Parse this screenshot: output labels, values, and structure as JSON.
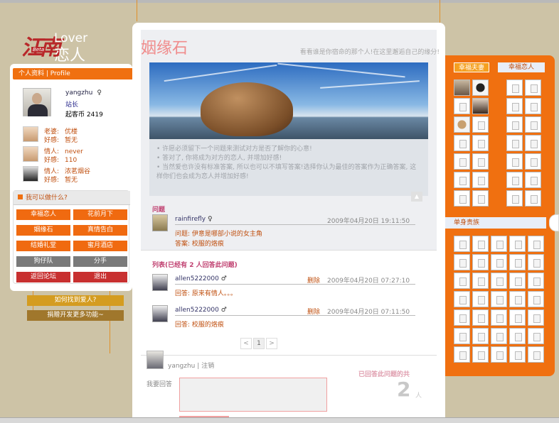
{
  "logo": {
    "cn": "江南",
    "beta": "Beta",
    "en": "Lover",
    "cn2": "恋人"
  },
  "profile": {
    "header": "个人资料 | Profile",
    "username": "yangzhu",
    "gender": "♀",
    "role": "站长",
    "coins_label": "起客币",
    "coins": "2419"
  },
  "relations": [
    {
      "rel": "老婆:",
      "name": "优楼",
      "fav_label": "好感:",
      "fav": "暂无"
    },
    {
      "rel": "情人:",
      "name": "never",
      "fav_label": "好感:",
      "fav": "110"
    },
    {
      "rel": "情人:",
      "name": "浓茗烟谷",
      "fav_label": "好感:",
      "fav": "暂无"
    }
  ],
  "actions": {
    "header": "我可以做什么?",
    "buttons": [
      "幸福恋人",
      "花前月下",
      "姻缘石",
      "真情告白",
      "结婚礼堂",
      "蜜月酒店",
      "狗仔队",
      "分手",
      "返回论坛",
      "退出"
    ]
  },
  "links": [
    "如何找到爱人?",
    "捐赠开发更多功能~"
  ],
  "center": {
    "title": "姻缘石",
    "slogan": "看看谁是你宿命的那个人!在这里邂逅自己的缘分!",
    "tips": [
      "• 许愿必须留下一个问题来测试对方是否了解你的心意!",
      "• 答对了, 你将成为对方的恋人, 并增加好感!",
      "• 当然爱也许没有标准答案, 所以也可以不填写答案!选择你认为最佳的答案作为正确答案, 这样你们也会成为恋人并增加好感!"
    ],
    "question_label": "问题",
    "question": {
      "user": "rainfirefly",
      "gender": "♀",
      "time": "2009年04月20日 19:11:50",
      "q": "问题: 伊意是哪部小说的女主角",
      "a": "答案: 校服的烙痕"
    },
    "list_label": "列表(已经有 2 人回答此问题)",
    "answers": [
      {
        "user": "allen5222000",
        "gender": "♂",
        "del": "删除",
        "time": "2009年04月20日 07:27:10",
        "text": "回答: 原来有情人。。。"
      },
      {
        "user": "allen5222000",
        "gender": "♂",
        "del": "删除",
        "time": "2009年04月20日 07:11:50",
        "text": "回答: 校服的烙痕"
      }
    ],
    "pager": {
      "prev": "<",
      "page": "1",
      "next": ">"
    },
    "me": {
      "user": "yangzhu",
      "sep": "|",
      "logout": "注销"
    },
    "reply_label": "我要回答",
    "answered_text": "已回答此问题的共",
    "answered_count": "2",
    "answered_unit": "人"
  },
  "right": {
    "tab1": "幸福夫妻",
    "tab2": "幸福恋人",
    "single": "单身贵族"
  }
}
